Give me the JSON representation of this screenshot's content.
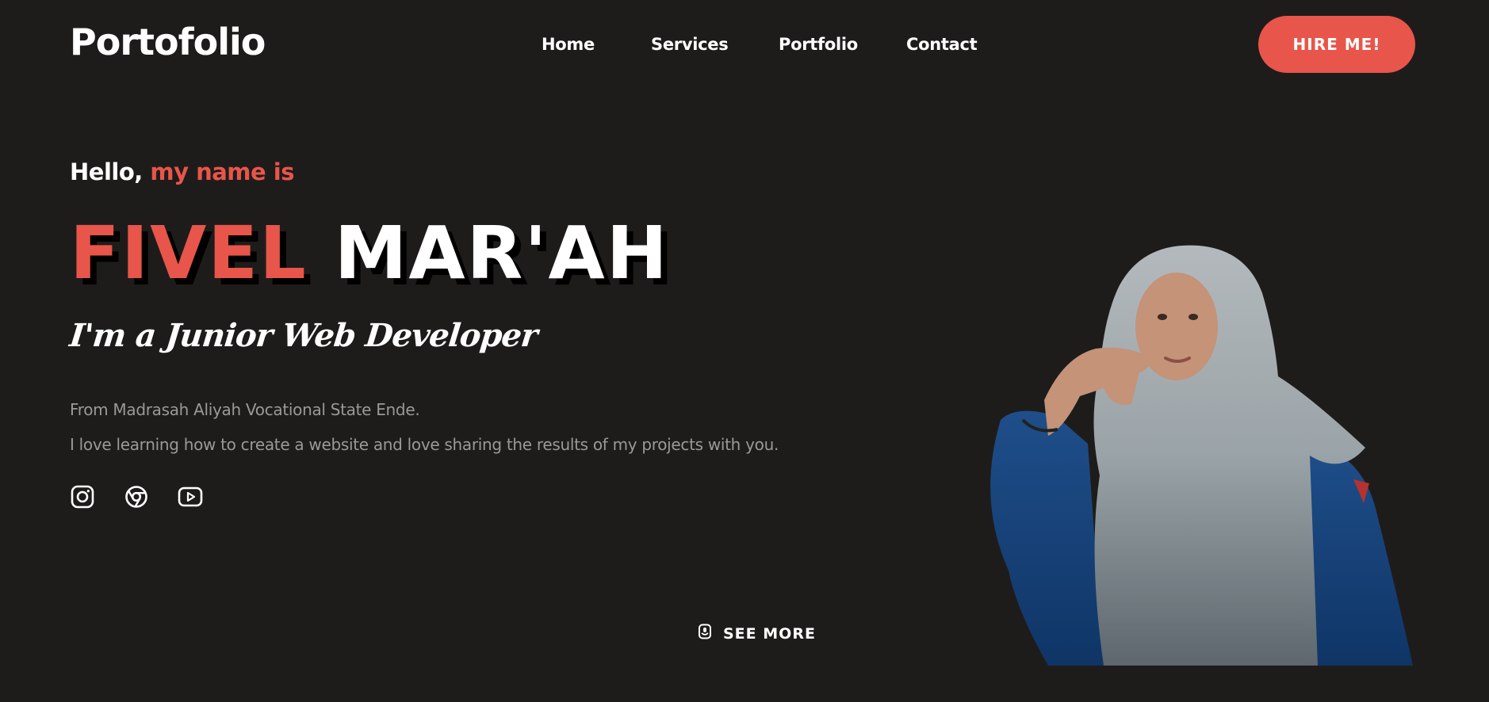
{
  "header": {
    "logo": "Portofolio",
    "nav": [
      "Home",
      "Services",
      "Portfolio",
      "Contact"
    ],
    "cta_label": "HIRE ME!"
  },
  "hero": {
    "greeting_lead": "Hello,",
    "greeting_accent": "my name is",
    "first_name": "FIVEL",
    "last_name": "MAR'AH",
    "role": "I'm a Junior Web Developer",
    "desc_line_1": "From Madrasah Aliyah Vocational State Ende.",
    "desc_line_2": "I love learning how to create a website and love sharing the results of my projects with you.",
    "socials": [
      "instagram-icon",
      "chrome-icon",
      "youtube-icon"
    ],
    "see_more_label": "SEE MORE"
  },
  "colors": {
    "background": "#1e1c1b",
    "accent": "#e8554a",
    "text": "#ffffff",
    "muted": "#9b9898"
  }
}
